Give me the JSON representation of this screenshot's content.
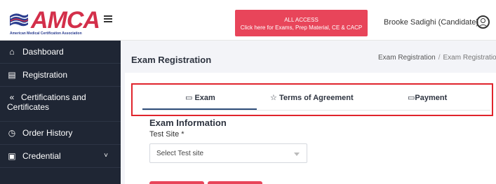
{
  "logo": {
    "text": "AMCA",
    "subtitle": "American Medical Certification Association"
  },
  "sidebar": {
    "items": [
      {
        "label": "Dashboard",
        "icon": "home-icon"
      },
      {
        "label": "Registration",
        "icon": "registration-icon"
      },
      {
        "label": "Certifications and Certificates",
        "icon": "certificates-icon"
      },
      {
        "label": "Order History",
        "icon": "clock-icon"
      },
      {
        "label": "Credential",
        "icon": "credential-icon"
      }
    ]
  },
  "topbar": {
    "access_title": "ALL ACCESS",
    "access_subtitle": "Click here for Exams, Prep Material, CE & CACP",
    "user_name": "Brooke Sadighi (Candidate)"
  },
  "page": {
    "title": "Exam Registration",
    "breadcrumb": [
      "Exam Registration",
      "Exam Registration"
    ]
  },
  "tabs": [
    {
      "label": "Exam",
      "icon": "exam-icon"
    },
    {
      "label": "Terms of Agreement",
      "icon": "star-icon"
    },
    {
      "label": "Payment",
      "icon": "card-icon"
    }
  ],
  "form": {
    "section_title": "Exam Information",
    "test_site_label": "Test Site *",
    "test_site_value": "Select Test site"
  },
  "colors": {
    "accent": "#e8455a",
    "sidebar_bg": "#1f2634",
    "highlight": "#e0242c"
  }
}
